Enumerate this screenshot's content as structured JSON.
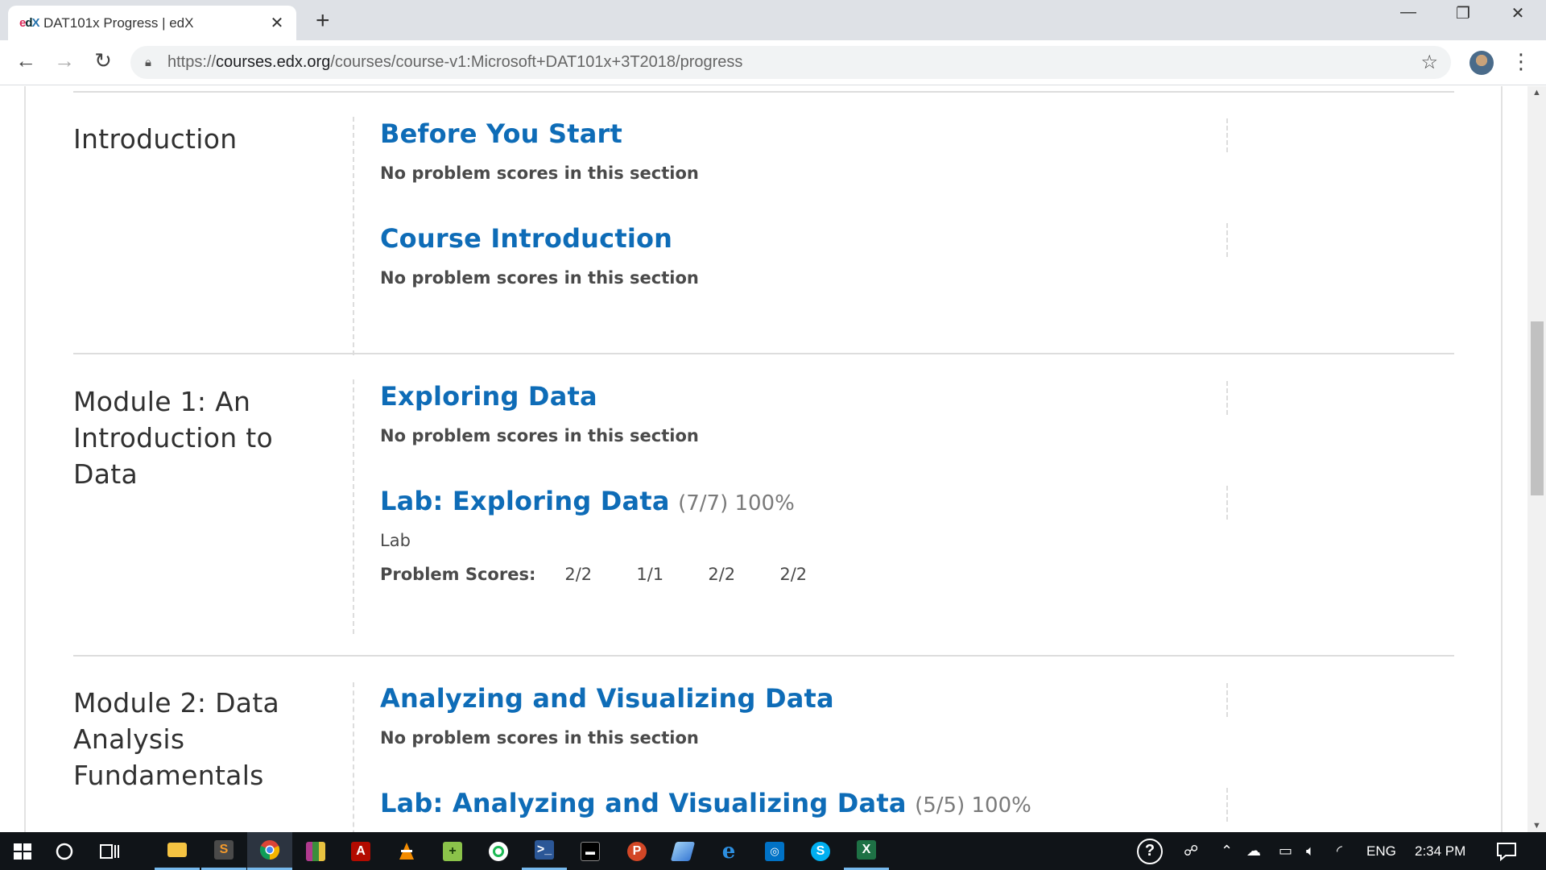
{
  "browser": {
    "tab_title": "DAT101x Progress | edX",
    "favicon_text": "edX",
    "url_scheme": "https://",
    "url_host": "courses.edx.org",
    "url_path": "/courses/course-v1:Microsoft+DAT101x+3T2018/progress"
  },
  "progress": {
    "sections": [
      {
        "chapter": "Introduction",
        "subsections": [
          {
            "title": "Before You Start",
            "note": "No problem scores in this section"
          },
          {
            "title": "Course Introduction",
            "note": "No problem scores in this section"
          }
        ]
      },
      {
        "chapter": "Module 1: An Introduction to Data",
        "subsections": [
          {
            "title": "Exploring Data",
            "note": "No problem scores in this section"
          },
          {
            "title": "Lab: Exploring Data",
            "score": "(7/7) 100%",
            "format": "Lab",
            "problem_scores_label": "Problem Scores:",
            "problem_scores": [
              "2/2",
              "1/1",
              "2/2",
              "2/2"
            ]
          }
        ]
      },
      {
        "chapter": "Module 2: Data Analysis Fundamentals",
        "subsections": [
          {
            "title": "Analyzing and Visualizing Data",
            "note": "No problem scores in this section"
          },
          {
            "title": "Lab: Analyzing and Visualizing Data",
            "score": "(5/5) 100%"
          }
        ]
      }
    ]
  },
  "taskbar": {
    "language": "ENG",
    "time": "2:34 PM",
    "apps": [
      "file-explorer",
      "sublime-text",
      "chrome",
      "winrar",
      "acrobat",
      "vlc",
      "notepad-plus",
      "spotify",
      "powershell",
      "terminal",
      "powerpoint",
      "photos",
      "edge",
      "outlook",
      "skype",
      "excel"
    ]
  },
  "colors": {
    "link": "#0e6cb7",
    "chapter_text": "#313131",
    "tab_strip": "#dee1e6",
    "taskbar": "#101418"
  }
}
